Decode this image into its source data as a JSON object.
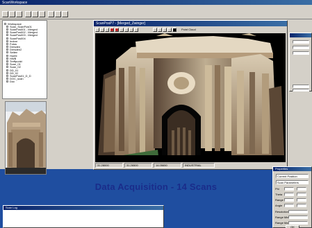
{
  "app": {
    "title": "ScanWorkspace",
    "menu": [
      "File",
      "Window"
    ]
  },
  "tree": {
    "items": [
      "Workspace",
      "Scan_ScanPos01",
      "ScanPos001 - Merged",
      "ScanPos002 - Merged",
      "ScanPos003 - Merged",
      "ScanPos004",
      "Indoor",
      "Fotos",
      "Dresden",
      "Dresden2",
      "Seiten",
      "Hoefe",
      "HWB",
      "Treffpunkt",
      "Scan_01",
      "Scan_02",
      "DD_01",
      "DD_02",
      "ScanPos01_D_D",
      "DOC_scan",
      "Doc"
    ]
  },
  "viewer": {
    "title": "ScanPosP7 - [Merged_Zwinger]",
    "right_toolbar_label": "Point Cloud",
    "status": [
      "31.28000",
      "31.26500",
      "14.05650",
      "INDUSTRIAL"
    ]
  },
  "caption": "Data Acquisition - 14 Scans",
  "dialog": {
    "title": "Properties",
    "select1": "Current Position",
    "select2": "Scan Parameters",
    "rows": [
      "Phi",
      "Theta",
      "Range",
      "Angle"
    ],
    "labels": [
      "Resolution",
      "Range Min",
      "Range Max"
    ],
    "ok_label": "OK"
  },
  "bottom_window": {
    "title": "Scan Log"
  },
  "colors": {
    "desktop": "#1f4ea0",
    "caption": "#1a2c8a",
    "titlebar": "#0a246a",
    "chrome": "#d4d0c8"
  }
}
